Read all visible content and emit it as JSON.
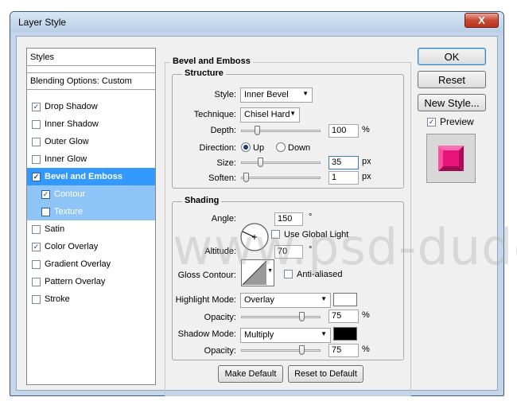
{
  "window": {
    "title": "Layer Style",
    "close_label": "X"
  },
  "styles": {
    "header": "Styles",
    "blending": "Blending Options: Custom",
    "items": [
      {
        "label": "Drop Shadow",
        "checked": true
      },
      {
        "label": "Inner Shadow",
        "checked": false
      },
      {
        "label": "Outer Glow",
        "checked": false
      },
      {
        "label": "Inner Glow",
        "checked": false
      },
      {
        "label": "Bevel and Emboss",
        "checked": true,
        "selected": true
      },
      {
        "label": "Contour",
        "checked": true,
        "sub": true
      },
      {
        "label": "Texture",
        "checked": false,
        "sub": true
      },
      {
        "label": "Satin",
        "checked": false
      },
      {
        "label": "Color Overlay",
        "checked": true
      },
      {
        "label": "Gradient Overlay",
        "checked": false
      },
      {
        "label": "Pattern Overlay",
        "checked": false
      },
      {
        "label": "Stroke",
        "checked": false
      }
    ]
  },
  "bevel": {
    "title": "Bevel and Emboss",
    "structure": {
      "title": "Structure",
      "style_label": "Style:",
      "style_value": "Inner Bevel",
      "technique_label": "Technique:",
      "technique_value": "Chisel Hard",
      "depth_label": "Depth:",
      "depth_value": "100",
      "depth_unit": "%",
      "direction_label": "Direction:",
      "up_label": "Up",
      "down_label": "Down",
      "size_label": "Size:",
      "size_value": "35",
      "size_unit": "px",
      "soften_label": "Soften:",
      "soften_value": "1",
      "soften_unit": "px"
    },
    "shading": {
      "title": "Shading",
      "angle_label": "Angle:",
      "angle_value": "150",
      "angle_unit": "°",
      "global_light_label": "Use Global Light",
      "altitude_label": "Altitude:",
      "altitude_value": "70",
      "altitude_unit": "°",
      "gloss_label": "Gloss Contour:",
      "anti_aliased_label": "Anti-aliased",
      "highlight_mode_label": "Highlight Mode:",
      "highlight_mode_value": "Overlay",
      "highlight_color": "#ffffff",
      "opacity_label": "Opacity:",
      "highlight_opacity": "75",
      "opacity_unit": "%",
      "shadow_mode_label": "Shadow Mode:",
      "shadow_mode_value": "Multiply",
      "shadow_color": "#000000",
      "shadow_opacity": "75"
    },
    "make_default": "Make Default",
    "reset_default": "Reset to Default"
  },
  "buttons": {
    "ok": "OK",
    "reset": "Reset",
    "new_style": "New Style...",
    "preview_label": "Preview"
  },
  "watermark": "www.psd-dude.com",
  "colors": {
    "preview_fill": "#e8147a",
    "selection": "#3399ff"
  }
}
